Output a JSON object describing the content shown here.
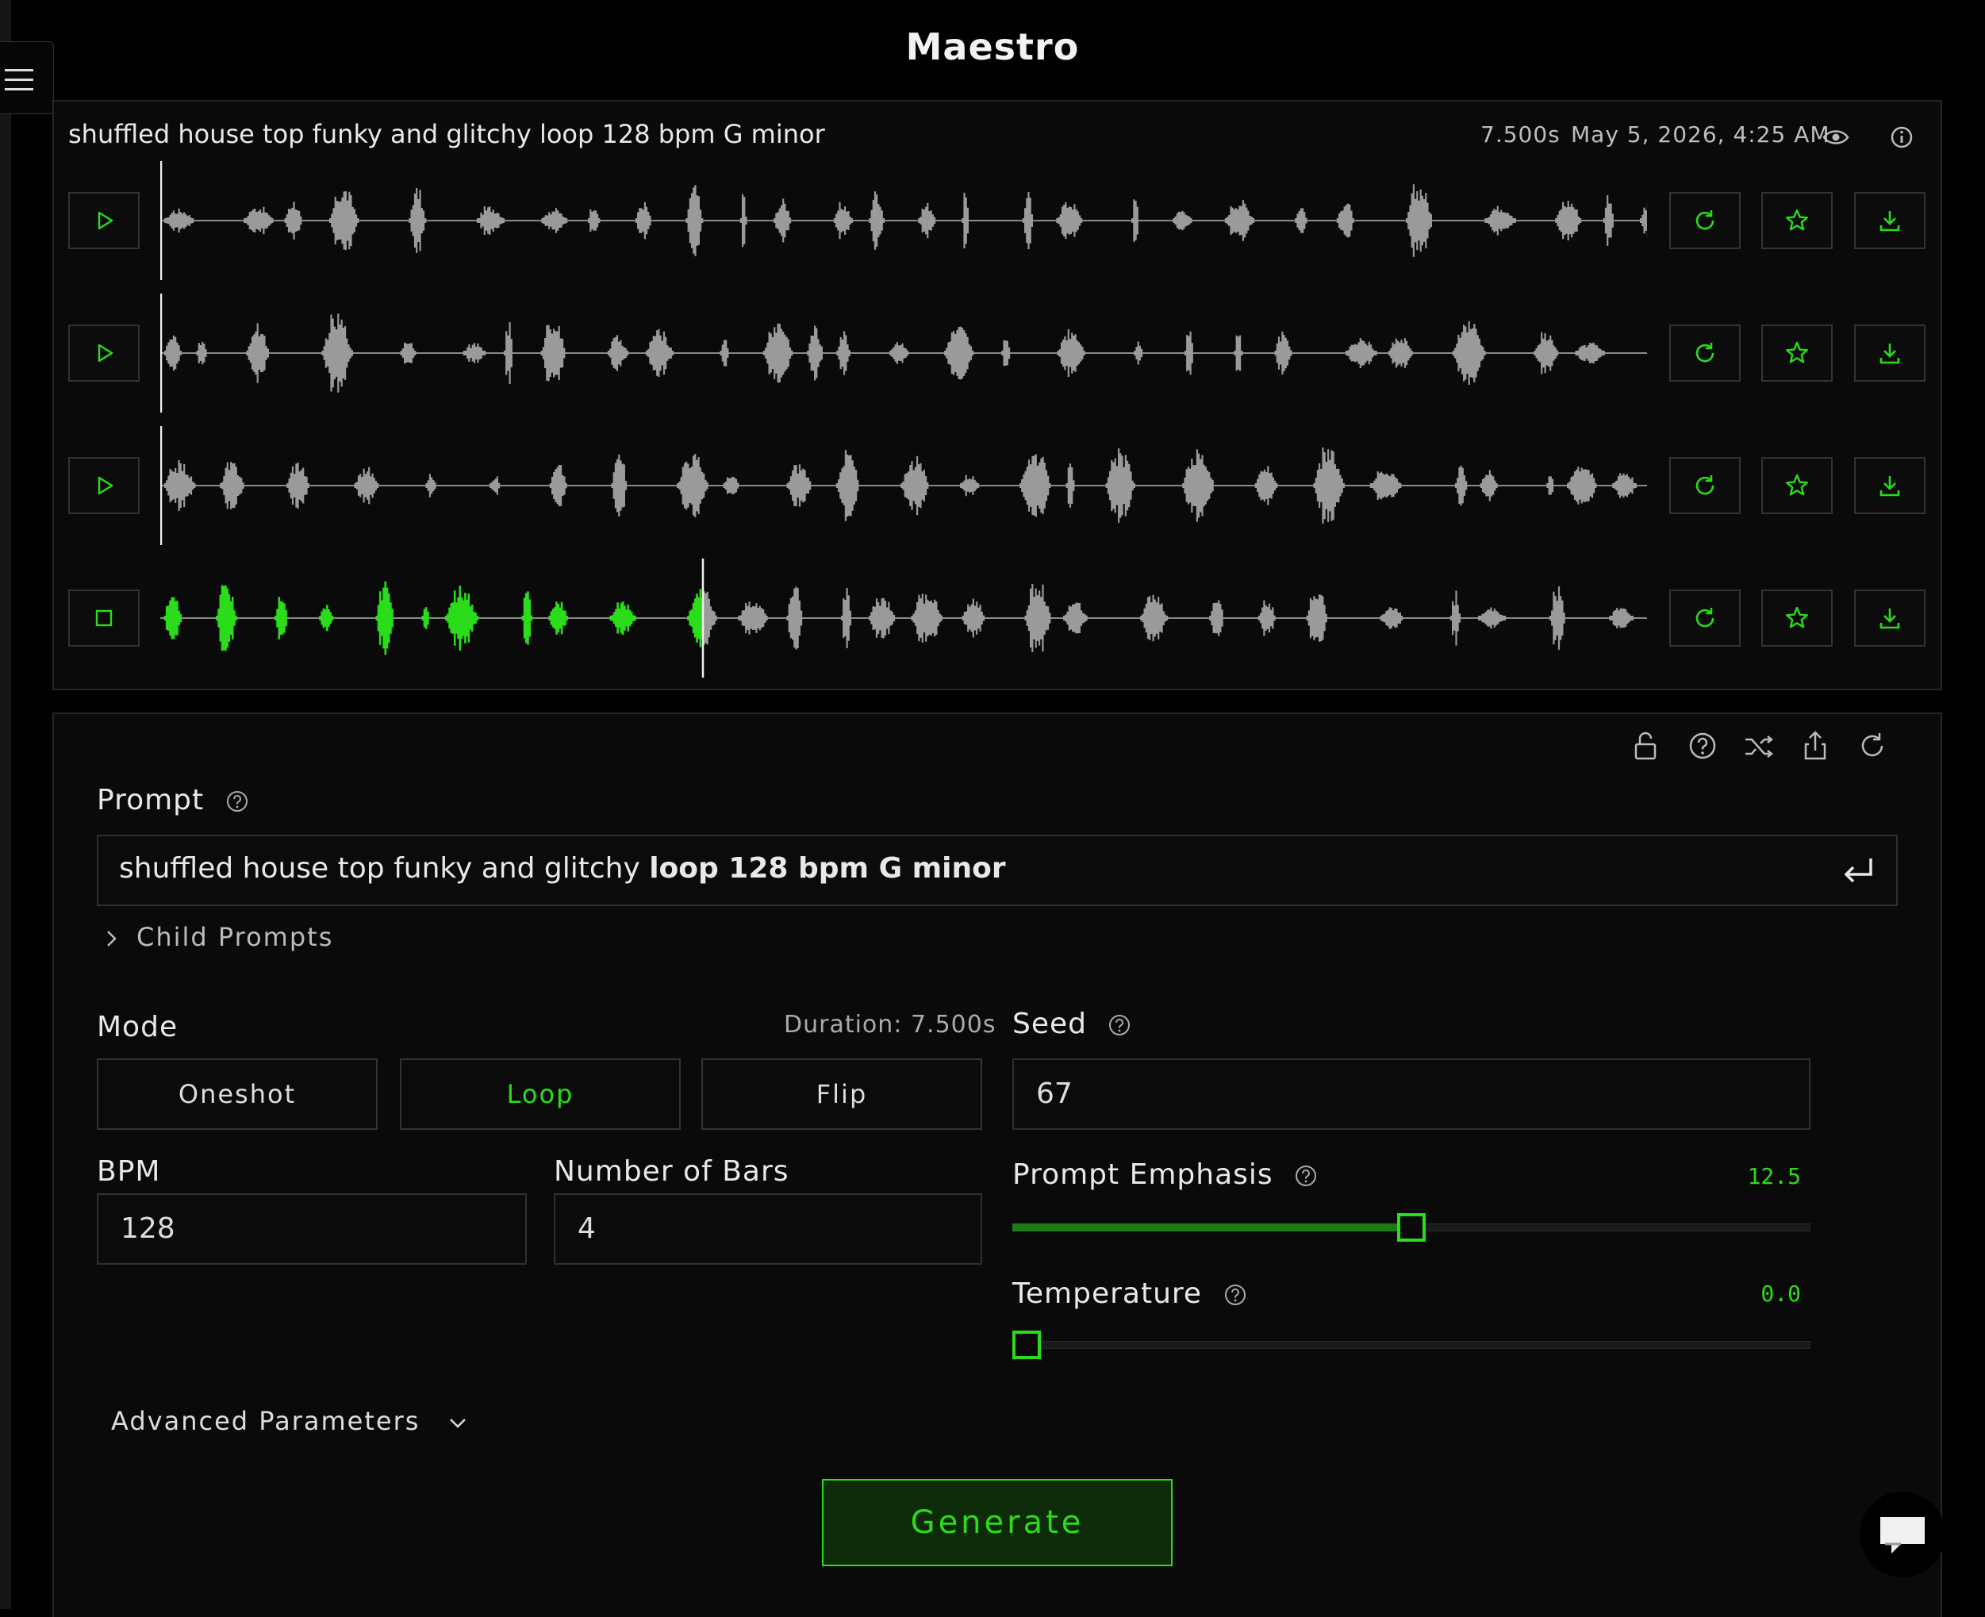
{
  "app": {
    "title": "Maestro",
    "accent": "#2bdc1a"
  },
  "generation": {
    "title": "shuffled house top funky and glitchy loop 128 bpm G minor",
    "duration": "7.500s",
    "timestamp": "May 5, 2026, 4:25 AM",
    "tracks": [
      {
        "state": "paused",
        "playback_progress": 0
      },
      {
        "state": "paused",
        "playback_progress": 0
      },
      {
        "state": "paused",
        "playback_progress": 0
      },
      {
        "state": "playing",
        "playback_progress": 0.365
      }
    ]
  },
  "form": {
    "prompt_label": "Prompt",
    "prompt_value_normal": "shuffled house top funky and glitchy ",
    "prompt_value_bold": "loop 128 bpm G minor",
    "child_prompts_label": "Child Prompts",
    "mode_label": "Mode",
    "duration_label": "Duration: 7.500s",
    "modes": [
      "Oneshot",
      "Loop",
      "Flip"
    ],
    "selected_mode": "Loop",
    "bpm_label": "BPM",
    "bpm_value": "128",
    "bars_label": "Number of Bars",
    "bars_value": "4",
    "seed_label": "Seed",
    "seed_value": "67",
    "emphasis_label": "Prompt Emphasis",
    "emphasis_value": "12.5",
    "emphasis_fraction": 0.5,
    "temperature_label": "Temperature",
    "temperature_value": "0.0",
    "temperature_fraction": 0.0,
    "advanced_label": "Advanced Parameters",
    "generate_label": "Generate"
  },
  "icons": {
    "menu": "hamburger-icon",
    "view": "eye-icon",
    "info": "info-icon",
    "play": "play-icon",
    "stop": "stop-icon",
    "regenerate": "refresh-icon",
    "favorite": "star-icon",
    "download": "download-icon",
    "lock": "lock-icon",
    "help": "help-icon",
    "shuffle": "shuffle-icon",
    "share": "share-icon",
    "reset": "reset-icon",
    "submit": "enter-icon",
    "chat": "chat-icon"
  }
}
